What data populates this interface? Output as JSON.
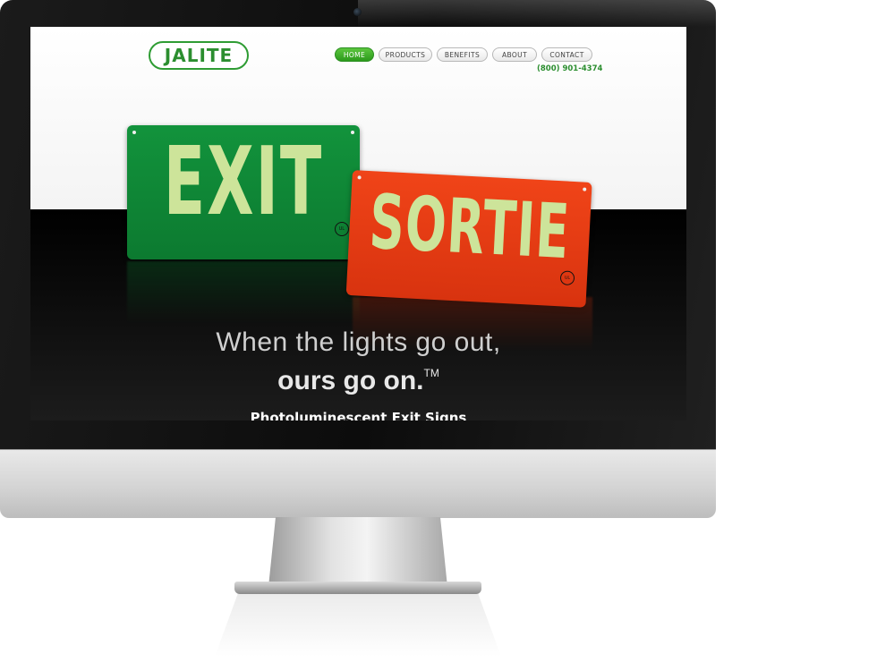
{
  "site": {
    "logo_text": "JALITE",
    "nav": [
      {
        "label": "HOME",
        "active": true
      },
      {
        "label": "PRODUCTS",
        "active": false
      },
      {
        "label": "BENEFITS",
        "active": false
      },
      {
        "label": "ABOUT",
        "active": false
      },
      {
        "label": "CONTACT",
        "active": false
      }
    ],
    "phone": "(800) 901-4374"
  },
  "hero": {
    "sign_exit_text": "EXIT",
    "sign_sortie_text": "SORTIE",
    "tagline_line1": "When the lights go out,",
    "tagline_line2": "ours go on.",
    "trademark": "TM",
    "subheading": "Photoluminescent Exit Signs"
  },
  "colors": {
    "brand_green": "#2b8e2f",
    "nav_active": "#3aab25",
    "exit_sign": "#12933c",
    "sortie_sign": "#e63c14",
    "glow_text": "#cde49a"
  },
  "icons": [
    "webcam-icon",
    "ul-certification-icon"
  ]
}
